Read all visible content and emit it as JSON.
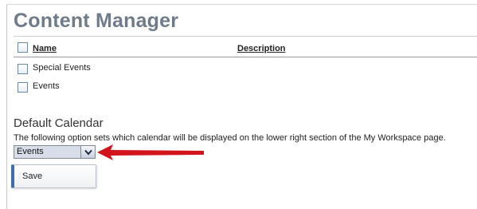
{
  "page": {
    "title": "Content Manager"
  },
  "table": {
    "columns": {
      "name": "Name",
      "description": "Description"
    },
    "rows": [
      {
        "label": "Special Events"
      },
      {
        "label": "Events"
      }
    ]
  },
  "default_calendar": {
    "heading": "Default Calendar",
    "description": "The following option sets which calendar will be displayed on the lower right section of the My Workspace page.",
    "selected": "Events"
  },
  "actions": {
    "save_label": "Save"
  },
  "colors": {
    "title": "#6e7b8a",
    "annotation_arrow": "#d2141c",
    "button_accent": "#3c6ea8"
  },
  "icons": {
    "dropdown": "chevron-down-icon",
    "annotation": "arrow-left-icon"
  }
}
